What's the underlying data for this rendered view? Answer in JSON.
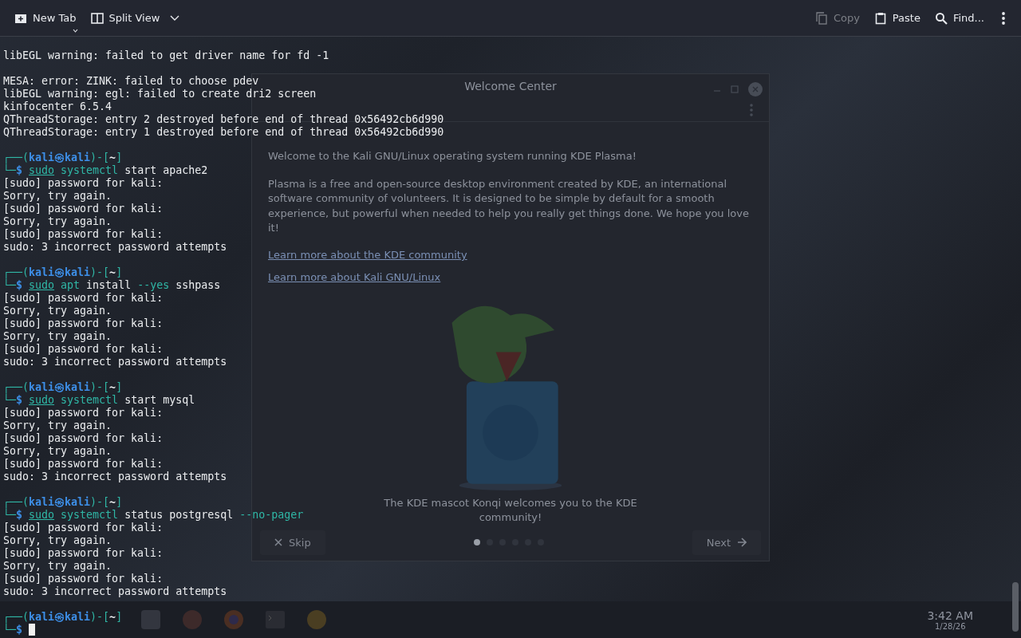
{
  "desktop": {
    "welcome_window": {
      "title": "Welcome Center",
      "intro": "Welcome to the Kali GNU/Linux operating system running KDE Plasma!",
      "body": "Plasma is a free and open-source desktop environment created by KDE, an international software community of volunteers. It is designed to be simple by default for a smooth experience, but powerful when needed to help you really get things done. We hope you love it!",
      "links": [
        "Learn more about the KDE community",
        "Learn more about Kali GNU/Linux"
      ],
      "caption": "The KDE mascot Konqi welcomes you to the KDE community!",
      "skip": "Skip",
      "next": "Next",
      "pages": [
        {
          "selected": true
        },
        {
          "selected": false
        },
        {
          "selected": false
        },
        {
          "selected": false
        },
        {
          "selected": false
        },
        {
          "selected": false
        }
      ]
    },
    "clock": {
      "time": "3:42 AM",
      "date": "1/28/26"
    }
  },
  "toolbar": {
    "left": [
      {
        "kind": "new-tab",
        "label": "New Tab",
        "disabled": false
      },
      {
        "kind": "split",
        "label": "Split View",
        "disabled": false
      }
    ],
    "right": [
      {
        "kind": "copy",
        "label": "Copy",
        "disabled": true
      },
      {
        "kind": "paste",
        "label": "Paste",
        "disabled": false
      },
      {
        "kind": "find",
        "label": "Find...",
        "disabled": false
      }
    ]
  },
  "terminal": {
    "cursor_visible": true,
    "lines": [
      {
        "kind": "text",
        "spans": [
          {
            "text": "libEGL warning: failed to get driver name for fd -1",
            "kind": "plain"
          }
        ]
      },
      {
        "kind": "blank"
      },
      {
        "kind": "text",
        "spans": [
          {
            "text": "MESA: error: ZINK: failed to choose pdev",
            "kind": "plain"
          }
        ]
      },
      {
        "kind": "text",
        "spans": [
          {
            "text": "libEGL warning: egl: failed to create dri2 screen",
            "kind": "plain"
          }
        ]
      },
      {
        "kind": "text",
        "spans": [
          {
            "text": "kinfocenter 6.5.4",
            "kind": "plain"
          }
        ]
      },
      {
        "kind": "text",
        "spans": [
          {
            "text": "QThreadStorage: entry 2 destroyed before end of thread 0x56492cb6d990",
            "kind": "plain"
          }
        ]
      },
      {
        "kind": "text",
        "spans": [
          {
            "text": "QThreadStorage: entry 1 destroyed before end of thread 0x56492cb6d990",
            "kind": "plain"
          }
        ]
      },
      {
        "kind": "blank"
      },
      {
        "kind": "text",
        "spans": [
          {
            "text": "┌──(",
            "kind": "frame"
          },
          {
            "text": "kali㉿kali",
            "kind": "user"
          },
          {
            "text": ")-[",
            "kind": "frame"
          },
          {
            "text": "~",
            "kind": "path"
          },
          {
            "text": "]",
            "kind": "frame"
          }
        ]
      },
      {
        "kind": "text",
        "spans": [
          {
            "text": "└─",
            "kind": "frame"
          },
          {
            "text": "$ ",
            "kind": "symbol"
          },
          {
            "text": "sudo",
            "kind": "builtin"
          },
          {
            "text": " systemctl",
            "kind": "command"
          },
          {
            "text": " start apache2",
            "kind": "plain"
          }
        ]
      },
      {
        "kind": "text",
        "spans": [
          {
            "text": "[sudo] password for kali:",
            "kind": "plain"
          }
        ]
      },
      {
        "kind": "text",
        "spans": [
          {
            "text": "Sorry, try again.",
            "kind": "plain"
          }
        ]
      },
      {
        "kind": "text",
        "spans": [
          {
            "text": "[sudo] password for kali:",
            "kind": "plain"
          }
        ]
      },
      {
        "kind": "text",
        "spans": [
          {
            "text": "Sorry, try again.",
            "kind": "plain"
          }
        ]
      },
      {
        "kind": "text",
        "spans": [
          {
            "text": "[sudo] password for kali:",
            "kind": "plain"
          }
        ]
      },
      {
        "kind": "text",
        "spans": [
          {
            "text": "sudo: 3 incorrect password attempts",
            "kind": "plain"
          }
        ]
      },
      {
        "kind": "blank"
      },
      {
        "kind": "text",
        "spans": [
          {
            "text": "┌──(",
            "kind": "frame"
          },
          {
            "text": "kali㉿kali",
            "kind": "user"
          },
          {
            "text": ")-[",
            "kind": "frame"
          },
          {
            "text": "~",
            "kind": "path"
          },
          {
            "text": "]",
            "kind": "frame"
          }
        ]
      },
      {
        "kind": "text",
        "spans": [
          {
            "text": "└─",
            "kind": "frame"
          },
          {
            "text": "$ ",
            "kind": "symbol"
          },
          {
            "text": "sudo",
            "kind": "builtin"
          },
          {
            "text": " apt",
            "kind": "command"
          },
          {
            "text": " install ",
            "kind": "plain"
          },
          {
            "text": "--yes",
            "kind": "option"
          },
          {
            "text": " sshpass",
            "kind": "plain"
          }
        ]
      },
      {
        "kind": "text",
        "spans": [
          {
            "text": "[sudo] password for kali:",
            "kind": "plain"
          }
        ]
      },
      {
        "kind": "text",
        "spans": [
          {
            "text": "Sorry, try again.",
            "kind": "plain"
          }
        ]
      },
      {
        "kind": "text",
        "spans": [
          {
            "text": "[sudo] password for kali:",
            "kind": "plain"
          }
        ]
      },
      {
        "kind": "text",
        "spans": [
          {
            "text": "Sorry, try again.",
            "kind": "plain"
          }
        ]
      },
      {
        "kind": "text",
        "spans": [
          {
            "text": "[sudo] password for kali:",
            "kind": "plain"
          }
        ]
      },
      {
        "kind": "text",
        "spans": [
          {
            "text": "sudo: 3 incorrect password attempts",
            "kind": "plain"
          }
        ]
      },
      {
        "kind": "blank"
      },
      {
        "kind": "text",
        "spans": [
          {
            "text": "┌──(",
            "kind": "frame"
          },
          {
            "text": "kali㉿kali",
            "kind": "user"
          },
          {
            "text": ")-[",
            "kind": "frame"
          },
          {
            "text": "~",
            "kind": "path"
          },
          {
            "text": "]",
            "kind": "frame"
          }
        ]
      },
      {
        "kind": "text",
        "spans": [
          {
            "text": "└─",
            "kind": "frame"
          },
          {
            "text": "$ ",
            "kind": "symbol"
          },
          {
            "text": "sudo",
            "kind": "builtin"
          },
          {
            "text": " systemctl",
            "kind": "command"
          },
          {
            "text": " start mysql",
            "kind": "plain"
          }
        ]
      },
      {
        "kind": "text",
        "spans": [
          {
            "text": "[sudo] password for kali:",
            "kind": "plain"
          }
        ]
      },
      {
        "kind": "text",
        "spans": [
          {
            "text": "Sorry, try again.",
            "kind": "plain"
          }
        ]
      },
      {
        "kind": "text",
        "spans": [
          {
            "text": "[sudo] password for kali:",
            "kind": "plain"
          }
        ]
      },
      {
        "kind": "text",
        "spans": [
          {
            "text": "Sorry, try again.",
            "kind": "plain"
          }
        ]
      },
      {
        "kind": "text",
        "spans": [
          {
            "text": "[sudo] password for kali:",
            "kind": "plain"
          }
        ]
      },
      {
        "kind": "text",
        "spans": [
          {
            "text": "sudo: 3 incorrect password attempts",
            "kind": "plain"
          }
        ]
      },
      {
        "kind": "blank"
      },
      {
        "kind": "text",
        "spans": [
          {
            "text": "┌──(",
            "kind": "frame"
          },
          {
            "text": "kali㉿kali",
            "kind": "user"
          },
          {
            "text": ")-[",
            "kind": "frame"
          },
          {
            "text": "~",
            "kind": "path"
          },
          {
            "text": "]",
            "kind": "frame"
          }
        ]
      },
      {
        "kind": "text",
        "spans": [
          {
            "text": "└─",
            "kind": "frame"
          },
          {
            "text": "$ ",
            "kind": "symbol"
          },
          {
            "text": "sudo",
            "kind": "builtin"
          },
          {
            "text": " systemctl",
            "kind": "command"
          },
          {
            "text": " status postgresql ",
            "kind": "plain"
          },
          {
            "text": "--no-pager",
            "kind": "option"
          }
        ]
      },
      {
        "kind": "text",
        "spans": [
          {
            "text": "[sudo] password for kali:",
            "kind": "plain"
          }
        ]
      },
      {
        "kind": "text",
        "spans": [
          {
            "text": "Sorry, try again.",
            "kind": "plain"
          }
        ]
      },
      {
        "kind": "text",
        "spans": [
          {
            "text": "[sudo] password for kali:",
            "kind": "plain"
          }
        ]
      },
      {
        "kind": "text",
        "spans": [
          {
            "text": "Sorry, try again.",
            "kind": "plain"
          }
        ]
      },
      {
        "kind": "text",
        "spans": [
          {
            "text": "[sudo] password for kali:",
            "kind": "plain"
          }
        ]
      },
      {
        "kind": "text",
        "spans": [
          {
            "text": "sudo: 3 incorrect password attempts",
            "kind": "plain"
          }
        ]
      },
      {
        "kind": "blank"
      },
      {
        "kind": "text",
        "spans": [
          {
            "text": "┌──(",
            "kind": "frame"
          },
          {
            "text": "kali㉿kali",
            "kind": "user"
          },
          {
            "text": ")-[",
            "kind": "frame"
          },
          {
            "text": "~",
            "kind": "path"
          },
          {
            "text": "]",
            "kind": "frame"
          }
        ]
      },
      {
        "kind": "text",
        "spans": [
          {
            "text": "└─",
            "kind": "frame"
          },
          {
            "text": "$ ",
            "kind": "symbol"
          }
        ]
      }
    ]
  }
}
